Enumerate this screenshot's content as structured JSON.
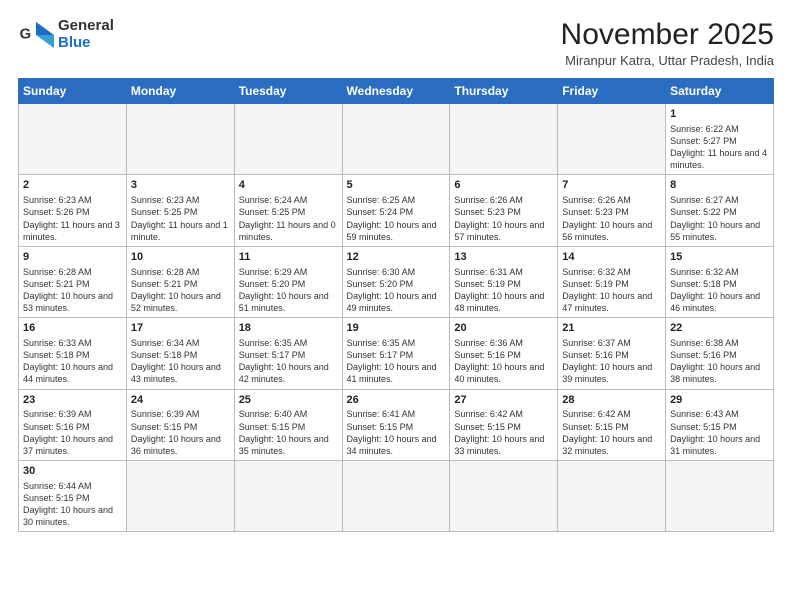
{
  "logo": {
    "line1": "General",
    "line2": "Blue"
  },
  "title": "November 2025",
  "subtitle": "Miranpur Katra, Uttar Pradesh, India",
  "weekdays": [
    "Sunday",
    "Monday",
    "Tuesday",
    "Wednesday",
    "Thursday",
    "Friday",
    "Saturday"
  ],
  "weeks": [
    [
      {
        "day": "",
        "info": ""
      },
      {
        "day": "",
        "info": ""
      },
      {
        "day": "",
        "info": ""
      },
      {
        "day": "",
        "info": ""
      },
      {
        "day": "",
        "info": ""
      },
      {
        "day": "",
        "info": ""
      },
      {
        "day": "1",
        "info": "Sunrise: 6:22 AM\nSunset: 5:27 PM\nDaylight: 11 hours and 4 minutes."
      }
    ],
    [
      {
        "day": "2",
        "info": "Sunrise: 6:23 AM\nSunset: 5:26 PM\nDaylight: 11 hours and 3 minutes."
      },
      {
        "day": "3",
        "info": "Sunrise: 6:23 AM\nSunset: 5:25 PM\nDaylight: 11 hours and 1 minute."
      },
      {
        "day": "4",
        "info": "Sunrise: 6:24 AM\nSunset: 5:25 PM\nDaylight: 11 hours and 0 minutes."
      },
      {
        "day": "5",
        "info": "Sunrise: 6:25 AM\nSunset: 5:24 PM\nDaylight: 10 hours and 59 minutes."
      },
      {
        "day": "6",
        "info": "Sunrise: 6:26 AM\nSunset: 5:23 PM\nDaylight: 10 hours and 57 minutes."
      },
      {
        "day": "7",
        "info": "Sunrise: 6:26 AM\nSunset: 5:23 PM\nDaylight: 10 hours and 56 minutes."
      },
      {
        "day": "8",
        "info": "Sunrise: 6:27 AM\nSunset: 5:22 PM\nDaylight: 10 hours and 55 minutes."
      }
    ],
    [
      {
        "day": "9",
        "info": "Sunrise: 6:28 AM\nSunset: 5:21 PM\nDaylight: 10 hours and 53 minutes."
      },
      {
        "day": "10",
        "info": "Sunrise: 6:28 AM\nSunset: 5:21 PM\nDaylight: 10 hours and 52 minutes."
      },
      {
        "day": "11",
        "info": "Sunrise: 6:29 AM\nSunset: 5:20 PM\nDaylight: 10 hours and 51 minutes."
      },
      {
        "day": "12",
        "info": "Sunrise: 6:30 AM\nSunset: 5:20 PM\nDaylight: 10 hours and 49 minutes."
      },
      {
        "day": "13",
        "info": "Sunrise: 6:31 AM\nSunset: 5:19 PM\nDaylight: 10 hours and 48 minutes."
      },
      {
        "day": "14",
        "info": "Sunrise: 6:32 AM\nSunset: 5:19 PM\nDaylight: 10 hours and 47 minutes."
      },
      {
        "day": "15",
        "info": "Sunrise: 6:32 AM\nSunset: 5:18 PM\nDaylight: 10 hours and 46 minutes."
      }
    ],
    [
      {
        "day": "16",
        "info": "Sunrise: 6:33 AM\nSunset: 5:18 PM\nDaylight: 10 hours and 44 minutes."
      },
      {
        "day": "17",
        "info": "Sunrise: 6:34 AM\nSunset: 5:18 PM\nDaylight: 10 hours and 43 minutes."
      },
      {
        "day": "18",
        "info": "Sunrise: 6:35 AM\nSunset: 5:17 PM\nDaylight: 10 hours and 42 minutes."
      },
      {
        "day": "19",
        "info": "Sunrise: 6:35 AM\nSunset: 5:17 PM\nDaylight: 10 hours and 41 minutes."
      },
      {
        "day": "20",
        "info": "Sunrise: 6:36 AM\nSunset: 5:16 PM\nDaylight: 10 hours and 40 minutes."
      },
      {
        "day": "21",
        "info": "Sunrise: 6:37 AM\nSunset: 5:16 PM\nDaylight: 10 hours and 39 minutes."
      },
      {
        "day": "22",
        "info": "Sunrise: 6:38 AM\nSunset: 5:16 PM\nDaylight: 10 hours and 38 minutes."
      }
    ],
    [
      {
        "day": "23",
        "info": "Sunrise: 6:39 AM\nSunset: 5:16 PM\nDaylight: 10 hours and 37 minutes."
      },
      {
        "day": "24",
        "info": "Sunrise: 6:39 AM\nSunset: 5:15 PM\nDaylight: 10 hours and 36 minutes."
      },
      {
        "day": "25",
        "info": "Sunrise: 6:40 AM\nSunset: 5:15 PM\nDaylight: 10 hours and 35 minutes."
      },
      {
        "day": "26",
        "info": "Sunrise: 6:41 AM\nSunset: 5:15 PM\nDaylight: 10 hours and 34 minutes."
      },
      {
        "day": "27",
        "info": "Sunrise: 6:42 AM\nSunset: 5:15 PM\nDaylight: 10 hours and 33 minutes."
      },
      {
        "day": "28",
        "info": "Sunrise: 6:42 AM\nSunset: 5:15 PM\nDaylight: 10 hours and 32 minutes."
      },
      {
        "day": "29",
        "info": "Sunrise: 6:43 AM\nSunset: 5:15 PM\nDaylight: 10 hours and 31 minutes."
      }
    ],
    [
      {
        "day": "30",
        "info": "Sunrise: 6:44 AM\nSunset: 5:15 PM\nDaylight: 10 hours and 30 minutes."
      },
      {
        "day": "",
        "info": ""
      },
      {
        "day": "",
        "info": ""
      },
      {
        "day": "",
        "info": ""
      },
      {
        "day": "",
        "info": ""
      },
      {
        "day": "",
        "info": ""
      },
      {
        "day": "",
        "info": ""
      }
    ]
  ]
}
